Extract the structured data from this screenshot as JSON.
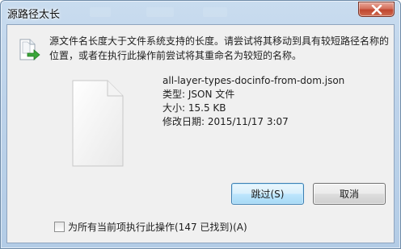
{
  "window": {
    "title": "源路径太长",
    "close_label": "关闭"
  },
  "dialog": {
    "message": "源文件名长度大于文件系统支持的长度。请尝试将其移动到具有较短路径名称的位置，或者在执行此操作前尝试将其重命名为较短的名称。",
    "file": {
      "name": "all-layer-types-docinfo-from-dom.json",
      "type_line": "类型: JSON 文件",
      "size_line": "大小: 15.5 KB",
      "modified_line": "修改日期: 2015/11/17 3:07"
    },
    "buttons": {
      "skip": "跳过(S)",
      "cancel": "取消"
    },
    "apply_all": {
      "label": "为所有当前项执行此操作(147 已找到)(A)",
      "checked": false
    }
  },
  "icons": {
    "header": "move-file-icon",
    "file": "blank-document-icon",
    "close": "close-icon"
  }
}
